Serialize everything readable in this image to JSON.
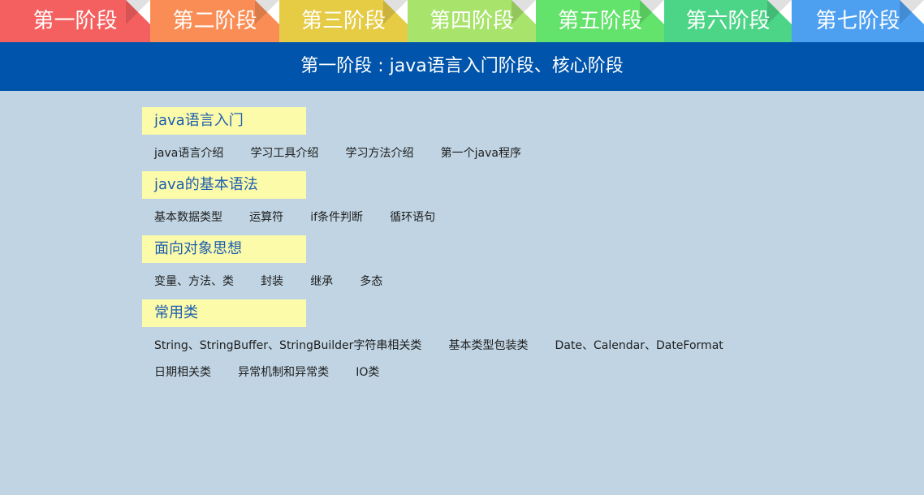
{
  "tabs": [
    {
      "label": "第一阶段",
      "color": "#f4605f"
    },
    {
      "label": "第二阶段",
      "color": "#f98d55"
    },
    {
      "label": "第三阶段",
      "color": "#e6cb45"
    },
    {
      "label": "第四阶段",
      "color": "#a8e36c"
    },
    {
      "label": "第五阶段",
      "color": "#63e36b"
    },
    {
      "label": "第六阶段",
      "color": "#4cd487"
    },
    {
      "label": "第七阶段",
      "color": "#4d9ff0"
    }
  ],
  "stage_header": {
    "title": "第一阶段 : java语言入门阶段、核心阶段",
    "background": "#0054ab"
  },
  "sections": [
    {
      "title": "java语言入门",
      "items": [
        "java语言介绍",
        "学习工具介绍",
        "学习方法介绍",
        "第一个java程序"
      ]
    },
    {
      "title": "java的基本语法",
      "items": [
        "基本数据类型",
        "运算符",
        "if条件判断",
        "循环语句"
      ]
    },
    {
      "title": "面向对象思想",
      "items": [
        "变量、方法、类",
        "封装",
        "继承",
        "多态"
      ]
    },
    {
      "title": "常用类",
      "items": [
        "String、StringBuffer、StringBuilder字符串相关类",
        "基本类型包装类",
        "Date、Calendar、DateFormat",
        "日期相关类",
        "异常机制和异常类",
        "IO类"
      ]
    }
  ],
  "colors": {
    "page_background": "#c0d4e3",
    "section_title_bg": "#fbfba9",
    "section_title_text": "#1f5fb0"
  }
}
